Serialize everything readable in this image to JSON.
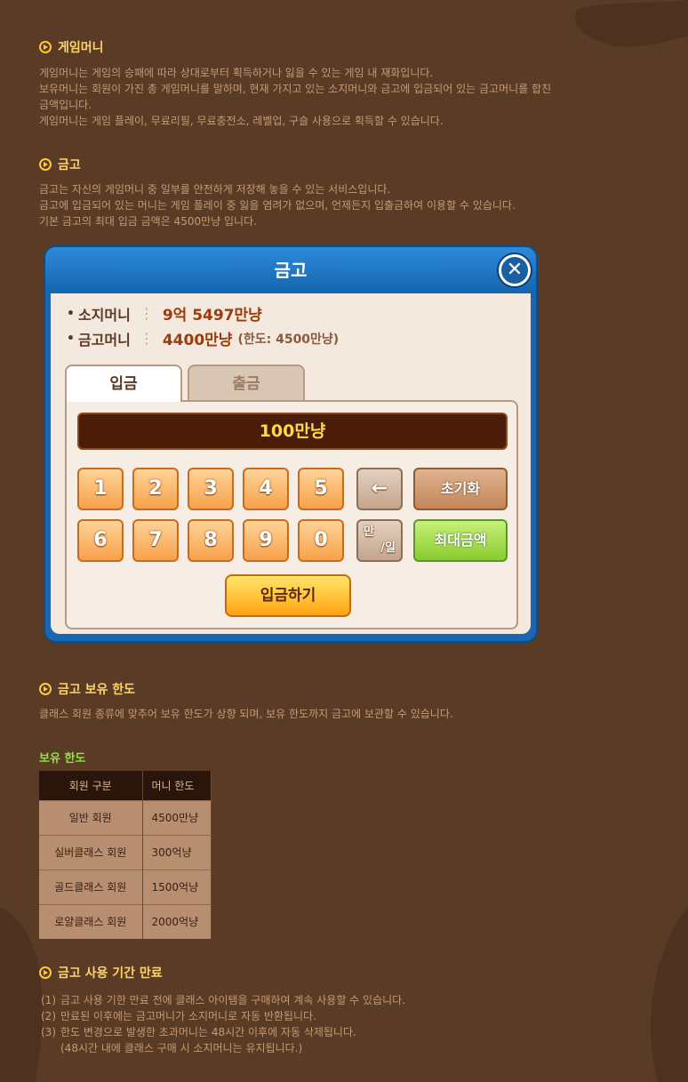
{
  "sections": {
    "game_money": {
      "title": "게임머니",
      "lines": [
        "게임머니는 게임의 승패에 따라 상대로부터 획득하거나 잃을 수 있는 게임 내 재화입니다.",
        "보유머니는 회원이 가진 총 게임머니를 말하며, 현재 가지고 있는 소지머니와 금고에 입금되어 있는 금고머니를 합친",
        "금액입니다.",
        "게임머니는 게임 플레이, 무료리필, 무료충전소, 레벨업, 구슬 사용으로 획득할 수 있습니다."
      ]
    },
    "safe": {
      "title": "금고",
      "lines": [
        "금고는 자신의 게임머니 중 일부를 안전하게 저장해 놓을 수 있는 서비스입니다.",
        "금고에 입금되어 있는 머니는 게임 플레이 중 잃을 염려가 없으며, 언제든지 입출금하여 이용할 수 있습니다.",
        "기본 금고의 최대 입금 금액은 4500만냥 입니다."
      ]
    },
    "limit": {
      "title": "금고 보유 한도",
      "lines": [
        "클래스 회원 종류에 맞추어 보유 한도가 상향 되며, 보유 한도까지 금고에 보관할 수 있습니다."
      ],
      "subheading": "보유 한도",
      "table": {
        "headers": [
          "회원 구분",
          "머니 한도"
        ],
        "rows": [
          [
            "일반 회원",
            "4500만냥"
          ],
          [
            "실버클래스 회원",
            "300억냥"
          ],
          [
            "골드클래스 회원",
            "1500억냥"
          ],
          [
            "로얄클래스 회원",
            "2000억냥"
          ]
        ]
      }
    },
    "expire": {
      "title": "금고 사용 기간 만료",
      "items": [
        [
          "(1)",
          "금고 사용 기한 만료 전에 클래스 아이템을 구매하여 계속 사용할 수 있습니다."
        ],
        [
          "(2)",
          "만료된 이후에는 금고머니가 소지머니로 자동 반환됩니다."
        ],
        [
          "(3)",
          "한도 변경으로 발생한 초과머니는 48시간 이후에 자동 삭제됩니다."
        ],
        [
          "",
          "(48시간 내에 클래스 구매 시 소지머니는 유지됩니다.)"
        ]
      ]
    }
  },
  "dialog": {
    "title": "금고",
    "close": "✕",
    "carried_label": "소지머니",
    "carried_value": "9억 5497만냥",
    "safe_label": "금고머니",
    "safe_value": "4400만냥",
    "safe_limit": "(한도: 4500만냥)",
    "tab_deposit": "입금",
    "tab_withdraw": "출금",
    "amount": "100만냥",
    "keys": [
      "1",
      "2",
      "3",
      "4",
      "5",
      "6",
      "7",
      "8",
      "9",
      "0"
    ],
    "backspace": "←",
    "reset": "초기화",
    "unit_top": "만",
    "unit_bottom": "/일",
    "max": "최대금액",
    "deposit_button": "입금하기"
  }
}
